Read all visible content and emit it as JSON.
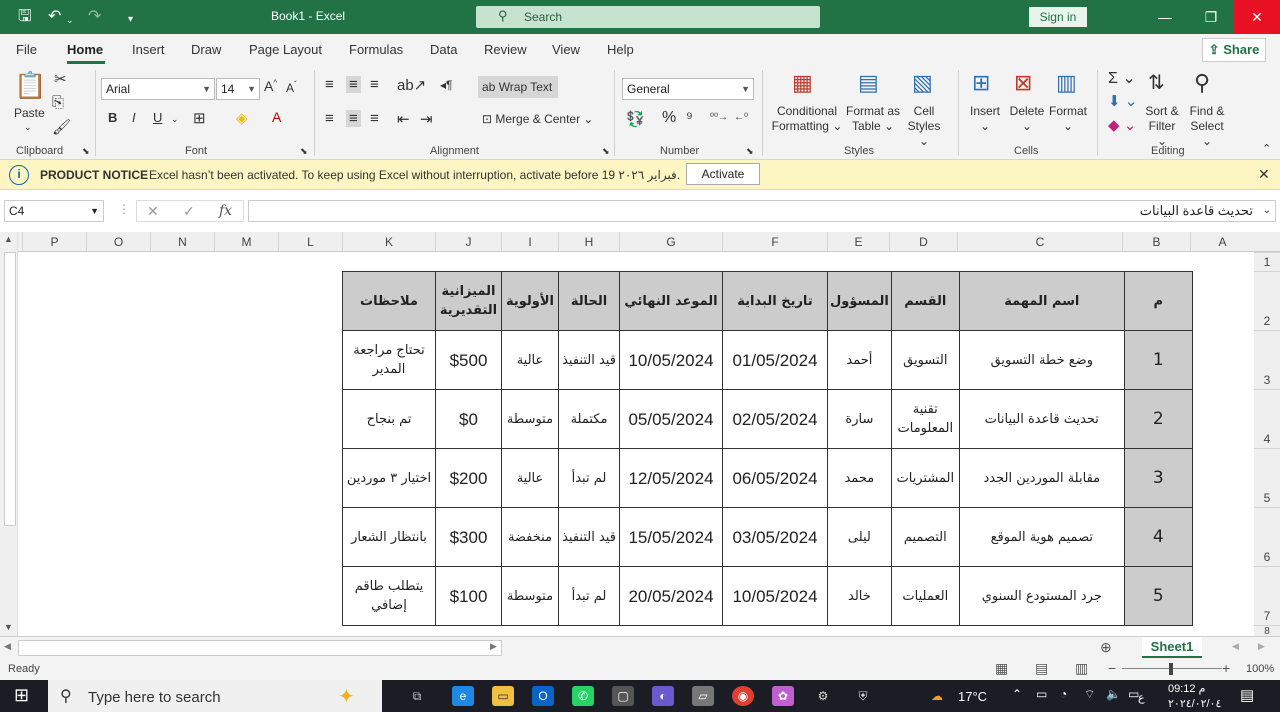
{
  "app": {
    "title": "Book1  -  Excel",
    "search_placeholder": "Search",
    "signin": "Sign in"
  },
  "menu": {
    "tabs": [
      "File",
      "Home",
      "Insert",
      "Draw",
      "Page Layout",
      "Formulas",
      "Data",
      "Review",
      "View",
      "Help"
    ],
    "share": "Share"
  },
  "ribbon": {
    "paste": "Paste",
    "font_name": "Arial",
    "font_size": "14",
    "wrap_text": "Wrap Text",
    "merge_center": "Merge & Center",
    "number_format": "General",
    "conditional_formatting": [
      "Conditional",
      "Formatting"
    ],
    "format_as_table": [
      "Format as",
      "Table"
    ],
    "cell_styles": [
      "Cell",
      "Styles"
    ],
    "insert": "Insert",
    "delete": "Delete",
    "format": "Format",
    "sort_filter": [
      "Sort &",
      "Filter"
    ],
    "find_select": [
      "Find &",
      "Select"
    ],
    "groups": {
      "clipboard": "Clipboard",
      "font": "Font",
      "alignment": "Alignment",
      "number": "Number",
      "styles": "Styles",
      "cells": "Cells",
      "editing": "Editing"
    }
  },
  "notice": {
    "title": "PRODUCT NOTICE",
    "message": "Excel hasn’t been activated. To keep using Excel without interruption, activate before 19 فبراير ٢٠٢٦.",
    "button": "Activate"
  },
  "formula": {
    "name_box": "C4",
    "fx": "fx",
    "value": "تحديث قاعدة البيانات"
  },
  "columns": [
    "A",
    "B",
    "C",
    "D",
    "E",
    "F",
    "G",
    "H",
    "I",
    "J",
    "K",
    "L",
    "M",
    "N",
    "O",
    "P"
  ],
  "rows": [
    "1",
    "2",
    "3",
    "4",
    "5",
    "6",
    "7",
    "8"
  ],
  "table": {
    "headers": [
      "م",
      "اسم المهمة",
      "القسم",
      "المسؤول",
      "تاريخ البداية",
      "الموعد النهائي",
      "الحالة",
      "الأولوية",
      "الميزانية التقديرية",
      "ملاحظات"
    ],
    "rows": [
      [
        "1",
        "وضع خطة التسويق",
        "التسويق",
        "أحمد",
        "01/05/2024",
        "10/05/2024",
        "قيد التنفيذ",
        "عالية",
        "$500",
        "تحتاج مراجعة المدير"
      ],
      [
        "2",
        "تحديث قاعدة البيانات",
        "تقنية المعلومات",
        "سارة",
        "02/05/2024",
        "05/05/2024",
        "مكتملة",
        "متوسطة",
        "$0",
        "تم بنجاح"
      ],
      [
        "3",
        "مقابلة الموردين الجدد",
        "المشتريات",
        "محمد",
        "06/05/2024",
        "12/05/2024",
        "لم تبدأ",
        "عالية",
        "$200",
        "اختيار ٣ موردين"
      ],
      [
        "4",
        "تصميم هوية الموقع",
        "التصميم",
        "ليلى",
        "03/05/2024",
        "15/05/2024",
        "قيد التنفيذ",
        "منخفضة",
        "$300",
        "بانتظار الشعار"
      ],
      [
        "5",
        "جرد المستودع السنوي",
        "العمليات",
        "خالد",
        "10/05/2024",
        "20/05/2024",
        "لم تبدأ",
        "متوسطة",
        "$100",
        "يتطلب طاقم إضافي"
      ]
    ]
  },
  "sheet": {
    "tab": "Sheet1"
  },
  "status": {
    "ready": "Ready",
    "zoom": "100%"
  },
  "taskbar": {
    "search": "Type here to search",
    "weather": "17°C",
    "time": "09:12 م",
    "date": "٢٠٢٤/٠٢/٠٤"
  }
}
